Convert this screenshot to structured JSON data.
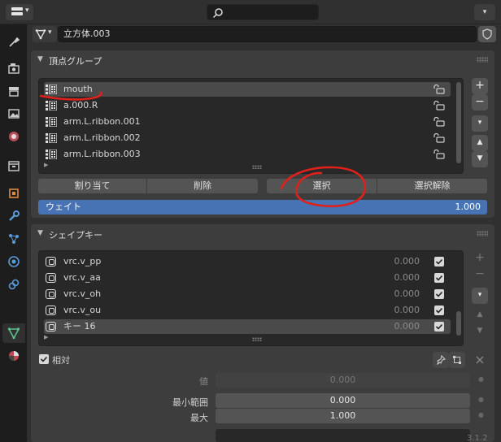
{
  "header": {
    "search_placeholder": ""
  },
  "object": {
    "name": "立方体.003"
  },
  "vertex_groups": {
    "title": "頂点グループ",
    "items": [
      {
        "name": "mouth",
        "selected": true
      },
      {
        "name": "a.000.R",
        "selected": false
      },
      {
        "name": "arm.L.ribbon.001",
        "selected": false
      },
      {
        "name": "arm.L.ribbon.002",
        "selected": false
      },
      {
        "name": "arm.L.ribbon.003",
        "selected": false
      }
    ],
    "buttons": {
      "assign": "割り当て",
      "remove": "削除",
      "select": "選択",
      "deselect": "選択解除"
    },
    "weight_label": "ウェイト",
    "weight_value": "1.000",
    "add_label": "+",
    "remove_label": "−"
  },
  "shape_keys": {
    "title": "シェイプキー",
    "items": [
      {
        "name": "vrc.v_pp",
        "value": "0.000",
        "checked": true
      },
      {
        "name": "vrc.v_aa",
        "value": "0.000",
        "checked": true
      },
      {
        "name": "vrc.v_oh",
        "value": "0.000",
        "checked": true
      },
      {
        "name": "vrc.v_ou",
        "value": "0.000",
        "checked": true
      },
      {
        "name": "キー 16",
        "value": "0.000",
        "checked": true,
        "selected": true
      }
    ],
    "relative_label": "相対",
    "value_label": "値",
    "value": "0.000",
    "range_min_label": "最小範囲",
    "range_min": "0.000",
    "max_label": "最大",
    "max": "1.000"
  },
  "version": "3.1.2",
  "colors": {
    "accent": "#4772b3",
    "panel": "#3d3d3d",
    "background": "#303030",
    "list_bg": "#282828",
    "annotation": "#e0201b"
  }
}
